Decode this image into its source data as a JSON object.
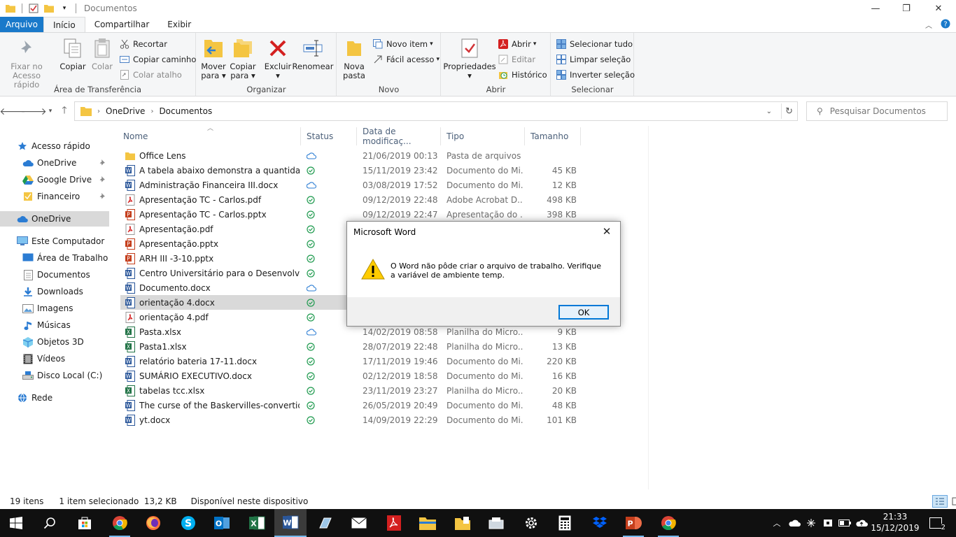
{
  "window": {
    "title": "Documentos",
    "controls": {
      "minimize": "—",
      "maximize": "❐",
      "close": "✕"
    }
  },
  "ribbon_tabs": [
    "Arquivo",
    "Início",
    "Compartilhar",
    "Exibir"
  ],
  "ribbon": {
    "clipboard": {
      "pin_label_1": "Fixar no",
      "pin_label_2": "Acesso rápido",
      "copy": "Copiar",
      "paste": "Colar",
      "cut": "Recortar",
      "copy_path": "Copiar caminho",
      "paste_shortcut": "Colar atalho",
      "group": "Área de Transferência"
    },
    "organize": {
      "move_1": "Mover",
      "move_2": "para",
      "copy_1": "Copiar",
      "copy_2": "para",
      "delete": "Excluir",
      "rename": "Renomear",
      "group": "Organizar"
    },
    "new": {
      "new_folder_1": "Nova",
      "new_folder_2": "pasta",
      "new_item": "Novo item",
      "easy_access": "Fácil acesso",
      "group": "Novo"
    },
    "open": {
      "properties": "Propriedades",
      "open": "Abrir",
      "edit": "Editar",
      "history": "Histórico",
      "group": "Abrir"
    },
    "select": {
      "select_all": "Selecionar tudo",
      "select_none": "Limpar seleção",
      "invert": "Inverter seleção",
      "group": "Selecionar"
    }
  },
  "address": {
    "crumbs": [
      "OneDrive",
      "Documentos"
    ],
    "search_placeholder": "Pesquisar Documentos"
  },
  "navpane": [
    {
      "label": "Acesso rápido",
      "icon": "star-icon",
      "indent": 0,
      "pinned": false
    },
    {
      "label": "OneDrive",
      "icon": "cloud-icon",
      "indent": 1,
      "pinned": true
    },
    {
      "label": "Google Drive",
      "icon": "google-drive-icon",
      "indent": 1,
      "pinned": true
    },
    {
      "label": "Financeiro",
      "icon": "folder-icon",
      "indent": 1,
      "pinned": true
    },
    {
      "label": "OneDrive",
      "icon": "cloud-icon",
      "indent": 0,
      "pinned": false,
      "selected": true
    },
    {
      "label": "Este Computador",
      "icon": "computer-icon",
      "indent": 0,
      "pinned": false
    },
    {
      "label": "Área de Trabalho",
      "icon": "desktop-icon",
      "indent": 1,
      "pinned": false
    },
    {
      "label": "Documentos",
      "icon": "documents-icon",
      "indent": 1,
      "pinned": false
    },
    {
      "label": "Downloads",
      "icon": "download-icon",
      "indent": 1,
      "pinned": false
    },
    {
      "label": "Imagens",
      "icon": "pictures-icon",
      "indent": 1,
      "pinned": false
    },
    {
      "label": "Músicas",
      "icon": "music-icon",
      "indent": 1,
      "pinned": false
    },
    {
      "label": "Objetos 3D",
      "icon": "cube-icon",
      "indent": 1,
      "pinned": false
    },
    {
      "label": "Vídeos",
      "icon": "video-icon",
      "indent": 1,
      "pinned": false
    },
    {
      "label": "Disco Local (C:)",
      "icon": "drive-icon",
      "indent": 1,
      "pinned": false
    },
    {
      "label": "Rede",
      "icon": "network-icon",
      "indent": 0,
      "pinned": false
    }
  ],
  "columns": [
    "Nome",
    "Status",
    "Data de modificaç...",
    "Tipo",
    "Tamanho"
  ],
  "files": [
    {
      "name": "Office Lens",
      "kind": "folder",
      "status": "cloud",
      "date": "21/06/2019 00:13",
      "type": "Pasta de arquivos",
      "size": ""
    },
    {
      "name": "A tabela abaixo demonstra a quantidade ...",
      "kind": "word",
      "status": "ok",
      "date": "15/11/2019 23:42",
      "type": "Documento do Mi...",
      "size": "45 KB"
    },
    {
      "name": "Administração Financeira III.docx",
      "kind": "word",
      "status": "cloud",
      "date": "03/08/2019 17:52",
      "type": "Documento do Mi...",
      "size": "12 KB"
    },
    {
      "name": "Apresentação TC - Carlos.pdf",
      "kind": "pdf",
      "status": "ok",
      "date": "09/12/2019 22:48",
      "type": "Adobe Acrobat D...",
      "size": "498 KB"
    },
    {
      "name": "Apresentação TC - Carlos.pptx",
      "kind": "ppt",
      "status": "ok",
      "date": "09/12/2019 22:47",
      "type": "Apresentação do ...",
      "size": "398 KB"
    },
    {
      "name": "Apresentação.pdf",
      "kind": "pdf",
      "status": "ok",
      "date": "",
      "type": "",
      "size": ""
    },
    {
      "name": "Apresentação.pptx",
      "kind": "ppt",
      "status": "ok",
      "date": "",
      "type": "",
      "size": ""
    },
    {
      "name": "ARH III -3-10.pptx",
      "kind": "ppt",
      "status": "ok",
      "date": "",
      "type": "",
      "size": ""
    },
    {
      "name": "Centro Universitário para o Desenvolvim...",
      "kind": "word",
      "status": "ok",
      "date": "",
      "type": "",
      "size": ""
    },
    {
      "name": "Documento.docx",
      "kind": "word",
      "status": "cloud",
      "date": "",
      "type": "",
      "size": ""
    },
    {
      "name": "orientação 4.docx",
      "kind": "word",
      "status": "ok",
      "date": "",
      "type": "",
      "size": "",
      "selected": true
    },
    {
      "name": "orientação 4.pdf",
      "kind": "pdf",
      "status": "ok",
      "date": "",
      "type": "",
      "size": ""
    },
    {
      "name": "Pasta.xlsx",
      "kind": "excel",
      "status": "cloud",
      "date": "14/02/2019 08:58",
      "type": "Planilha do Micro...",
      "size": "9 KB"
    },
    {
      "name": "Pasta1.xlsx",
      "kind": "excel",
      "status": "ok",
      "date": "28/07/2019 22:48",
      "type": "Planilha do Micro...",
      "size": "13 KB"
    },
    {
      "name": "relatório bateria 17-11.docx",
      "kind": "word",
      "status": "ok",
      "date": "17/11/2019 19:46",
      "type": "Documento do Mi...",
      "size": "220 KB"
    },
    {
      "name": "SUMÁRIO EXECUTIVO.docx",
      "kind": "word",
      "status": "ok",
      "date": "02/12/2019 18:58",
      "type": "Documento do Mi...",
      "size": "16 KB"
    },
    {
      "name": "tabelas tcc.xlsx",
      "kind": "excel",
      "status": "ok",
      "date": "23/11/2019 23:27",
      "type": "Planilha do Micro...",
      "size": "20 KB"
    },
    {
      "name": "The curse of the Baskervilles-convertido....",
      "kind": "word",
      "status": "ok",
      "date": "26/05/2019 20:49",
      "type": "Documento do Mi...",
      "size": "48 KB"
    },
    {
      "name": "yt.docx",
      "kind": "word",
      "status": "ok",
      "date": "14/09/2019 22:29",
      "type": "Documento do Mi...",
      "size": "101 KB"
    }
  ],
  "statusbar": {
    "count": "19 itens",
    "selection": "1 item selecionado  13,2 KB",
    "availability": "Disponível neste dispositivo"
  },
  "dialog": {
    "title": "Microsoft Word",
    "message": "O Word não pôde criar o arquivo de trabalho. Verifique a variável de ambiente temp.",
    "ok": "OK"
  },
  "taskbar": {
    "apps": [
      "start-icon",
      "search-icon",
      "store-icon",
      "chrome-icon",
      "firefox-icon",
      "skype-icon",
      "outlook-icon",
      "excel-icon",
      "word-icon",
      "notes-icon",
      "mail-icon",
      "acrobat-icon",
      "explorer-icon",
      "file-icon",
      "scanner-icon",
      "settings-icon",
      "calculator-icon",
      "dropbox-icon",
      "powerpoint-icon",
      "chrome-icon"
    ],
    "time": "21:33",
    "date": "15/12/2019",
    "notifications": "2"
  },
  "colors": {
    "accent": "#1979ca",
    "selection": "#d9d9d9",
    "sync_ok": "#1e9a4e",
    "cloud": "#2b7cd3",
    "taskbar": "#101010"
  }
}
